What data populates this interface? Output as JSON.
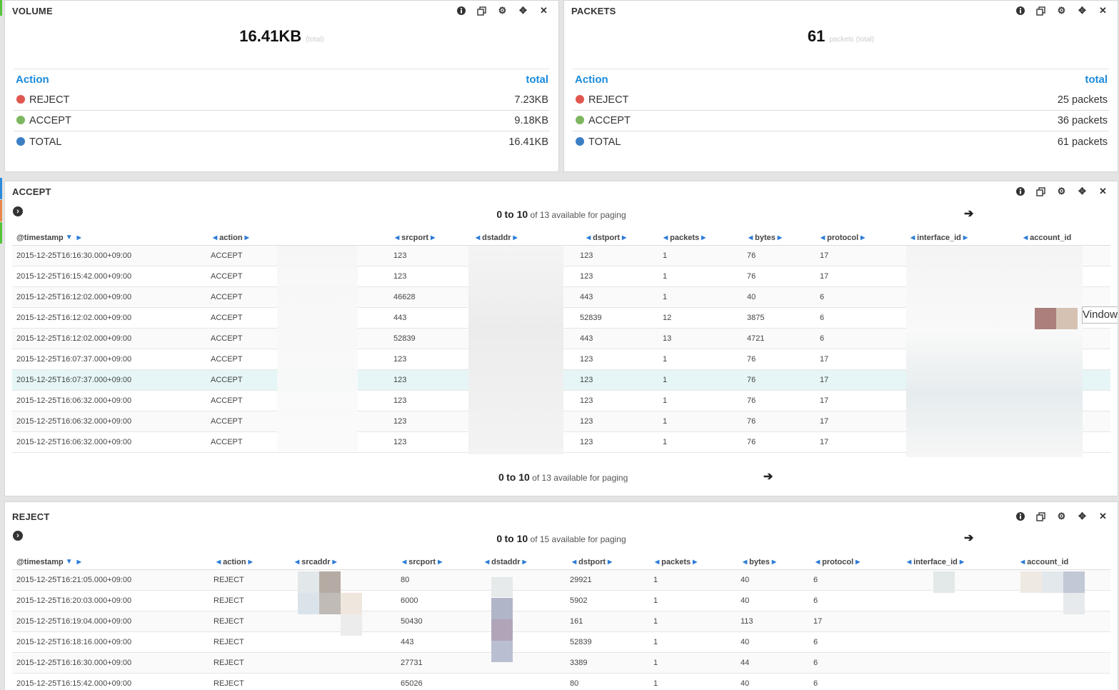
{
  "volume": {
    "title": "VOLUME",
    "value": "16.41KB",
    "sub": "(total)",
    "head_left": "Action",
    "head_right": "total",
    "rows": [
      {
        "label": "REJECT",
        "value": "7.23KB",
        "color": "#e0574f"
      },
      {
        "label": "ACCEPT",
        "value": "9.18KB",
        "color": "#7db65f"
      },
      {
        "label": "TOTAL",
        "value": "16.41KB",
        "color": "#3c7ec4"
      }
    ]
  },
  "packets": {
    "title": "PACKETS",
    "value": "61",
    "sub": "packets (total)",
    "head_left": "Action",
    "head_right": "total",
    "rows": [
      {
        "label": "REJECT",
        "value": "25 packets",
        "color": "#e0574f"
      },
      {
        "label": "ACCEPT",
        "value": "36 packets",
        "color": "#7db65f"
      },
      {
        "label": "TOTAL",
        "value": "61 packets",
        "color": "#3c7ec4"
      }
    ]
  },
  "accept": {
    "title": "ACCEPT",
    "paging_from": "0",
    "paging_to": "to 10",
    "paging_rest": "of 13 available for paging",
    "columns": [
      "@timestamp",
      "action",
      "srcport",
      "dstaddr",
      "dstport",
      "packets",
      "bytes",
      "protocol",
      "interface_id",
      "account_id"
    ],
    "rows": [
      [
        "2015-12-25T16:16:30.000+09:00",
        "ACCEPT",
        "123",
        "123",
        "1",
        "76",
        "17"
      ],
      [
        "2015-12-25T16:15:42.000+09:00",
        "ACCEPT",
        "123",
        "123",
        "1",
        "76",
        "17"
      ],
      [
        "2015-12-25T16:12:02.000+09:00",
        "ACCEPT",
        "46628",
        "443",
        "1",
        "40",
        "6"
      ],
      [
        "2015-12-25T16:12:02.000+09:00",
        "ACCEPT",
        "443",
        "52839",
        "12",
        "3875",
        "6"
      ],
      [
        "2015-12-25T16:12:02.000+09:00",
        "ACCEPT",
        "52839",
        "443",
        "13",
        "4721",
        "6"
      ],
      [
        "2015-12-25T16:07:37.000+09:00",
        "ACCEPT",
        "123",
        "123",
        "1",
        "76",
        "17"
      ],
      [
        "2015-12-25T16:07:37.000+09:00",
        "ACCEPT",
        "123",
        "123",
        "1",
        "76",
        "17"
      ],
      [
        "2015-12-25T16:06:32.000+09:00",
        "ACCEPT",
        "123",
        "123",
        "1",
        "76",
        "17"
      ],
      [
        "2015-12-25T16:06:32.000+09:00",
        "ACCEPT",
        "123",
        "123",
        "1",
        "76",
        "17"
      ],
      [
        "2015-12-25T16:06:32.000+09:00",
        "ACCEPT",
        "123",
        "123",
        "1",
        "76",
        "17"
      ]
    ],
    "overlay_text": "Vindows"
  },
  "reject": {
    "title": "REJECT",
    "paging_from": "0",
    "paging_to": "to 10",
    "paging_rest": "of 15 available for paging",
    "columns": [
      "@timestamp",
      "action",
      "srcaddr",
      "srcport",
      "dstaddr",
      "dstport",
      "packets",
      "bytes",
      "protocol",
      "interface_id",
      "account_id"
    ],
    "rows": [
      [
        "2015-12-25T16:21:05.000+09:00",
        "REJECT",
        "80",
        "29921",
        "1",
        "40",
        "6"
      ],
      [
        "2015-12-25T16:20:03.000+09:00",
        "REJECT",
        "6000",
        "5902",
        "1",
        "40",
        "6"
      ],
      [
        "2015-12-25T16:19:04.000+09:00",
        "REJECT",
        "50430",
        "161",
        "1",
        "113",
        "17"
      ],
      [
        "2015-12-25T16:18:16.000+09:00",
        "REJECT",
        "443",
        "52839",
        "1",
        "40",
        "6"
      ],
      [
        "2015-12-25T16:16:30.000+09:00",
        "REJECT",
        "27731",
        "3389",
        "1",
        "44",
        "6"
      ],
      [
        "2015-12-25T16:15:42.000+09:00",
        "REJECT",
        "65026",
        "80",
        "1",
        "40",
        "6"
      ]
    ]
  },
  "icons": [
    "info-icon",
    "copy-icon",
    "gear-icon",
    "move-icon",
    "close-icon",
    "chevron-right-circle-icon",
    "arrow-right-icon",
    "sort-arrow-icon"
  ]
}
